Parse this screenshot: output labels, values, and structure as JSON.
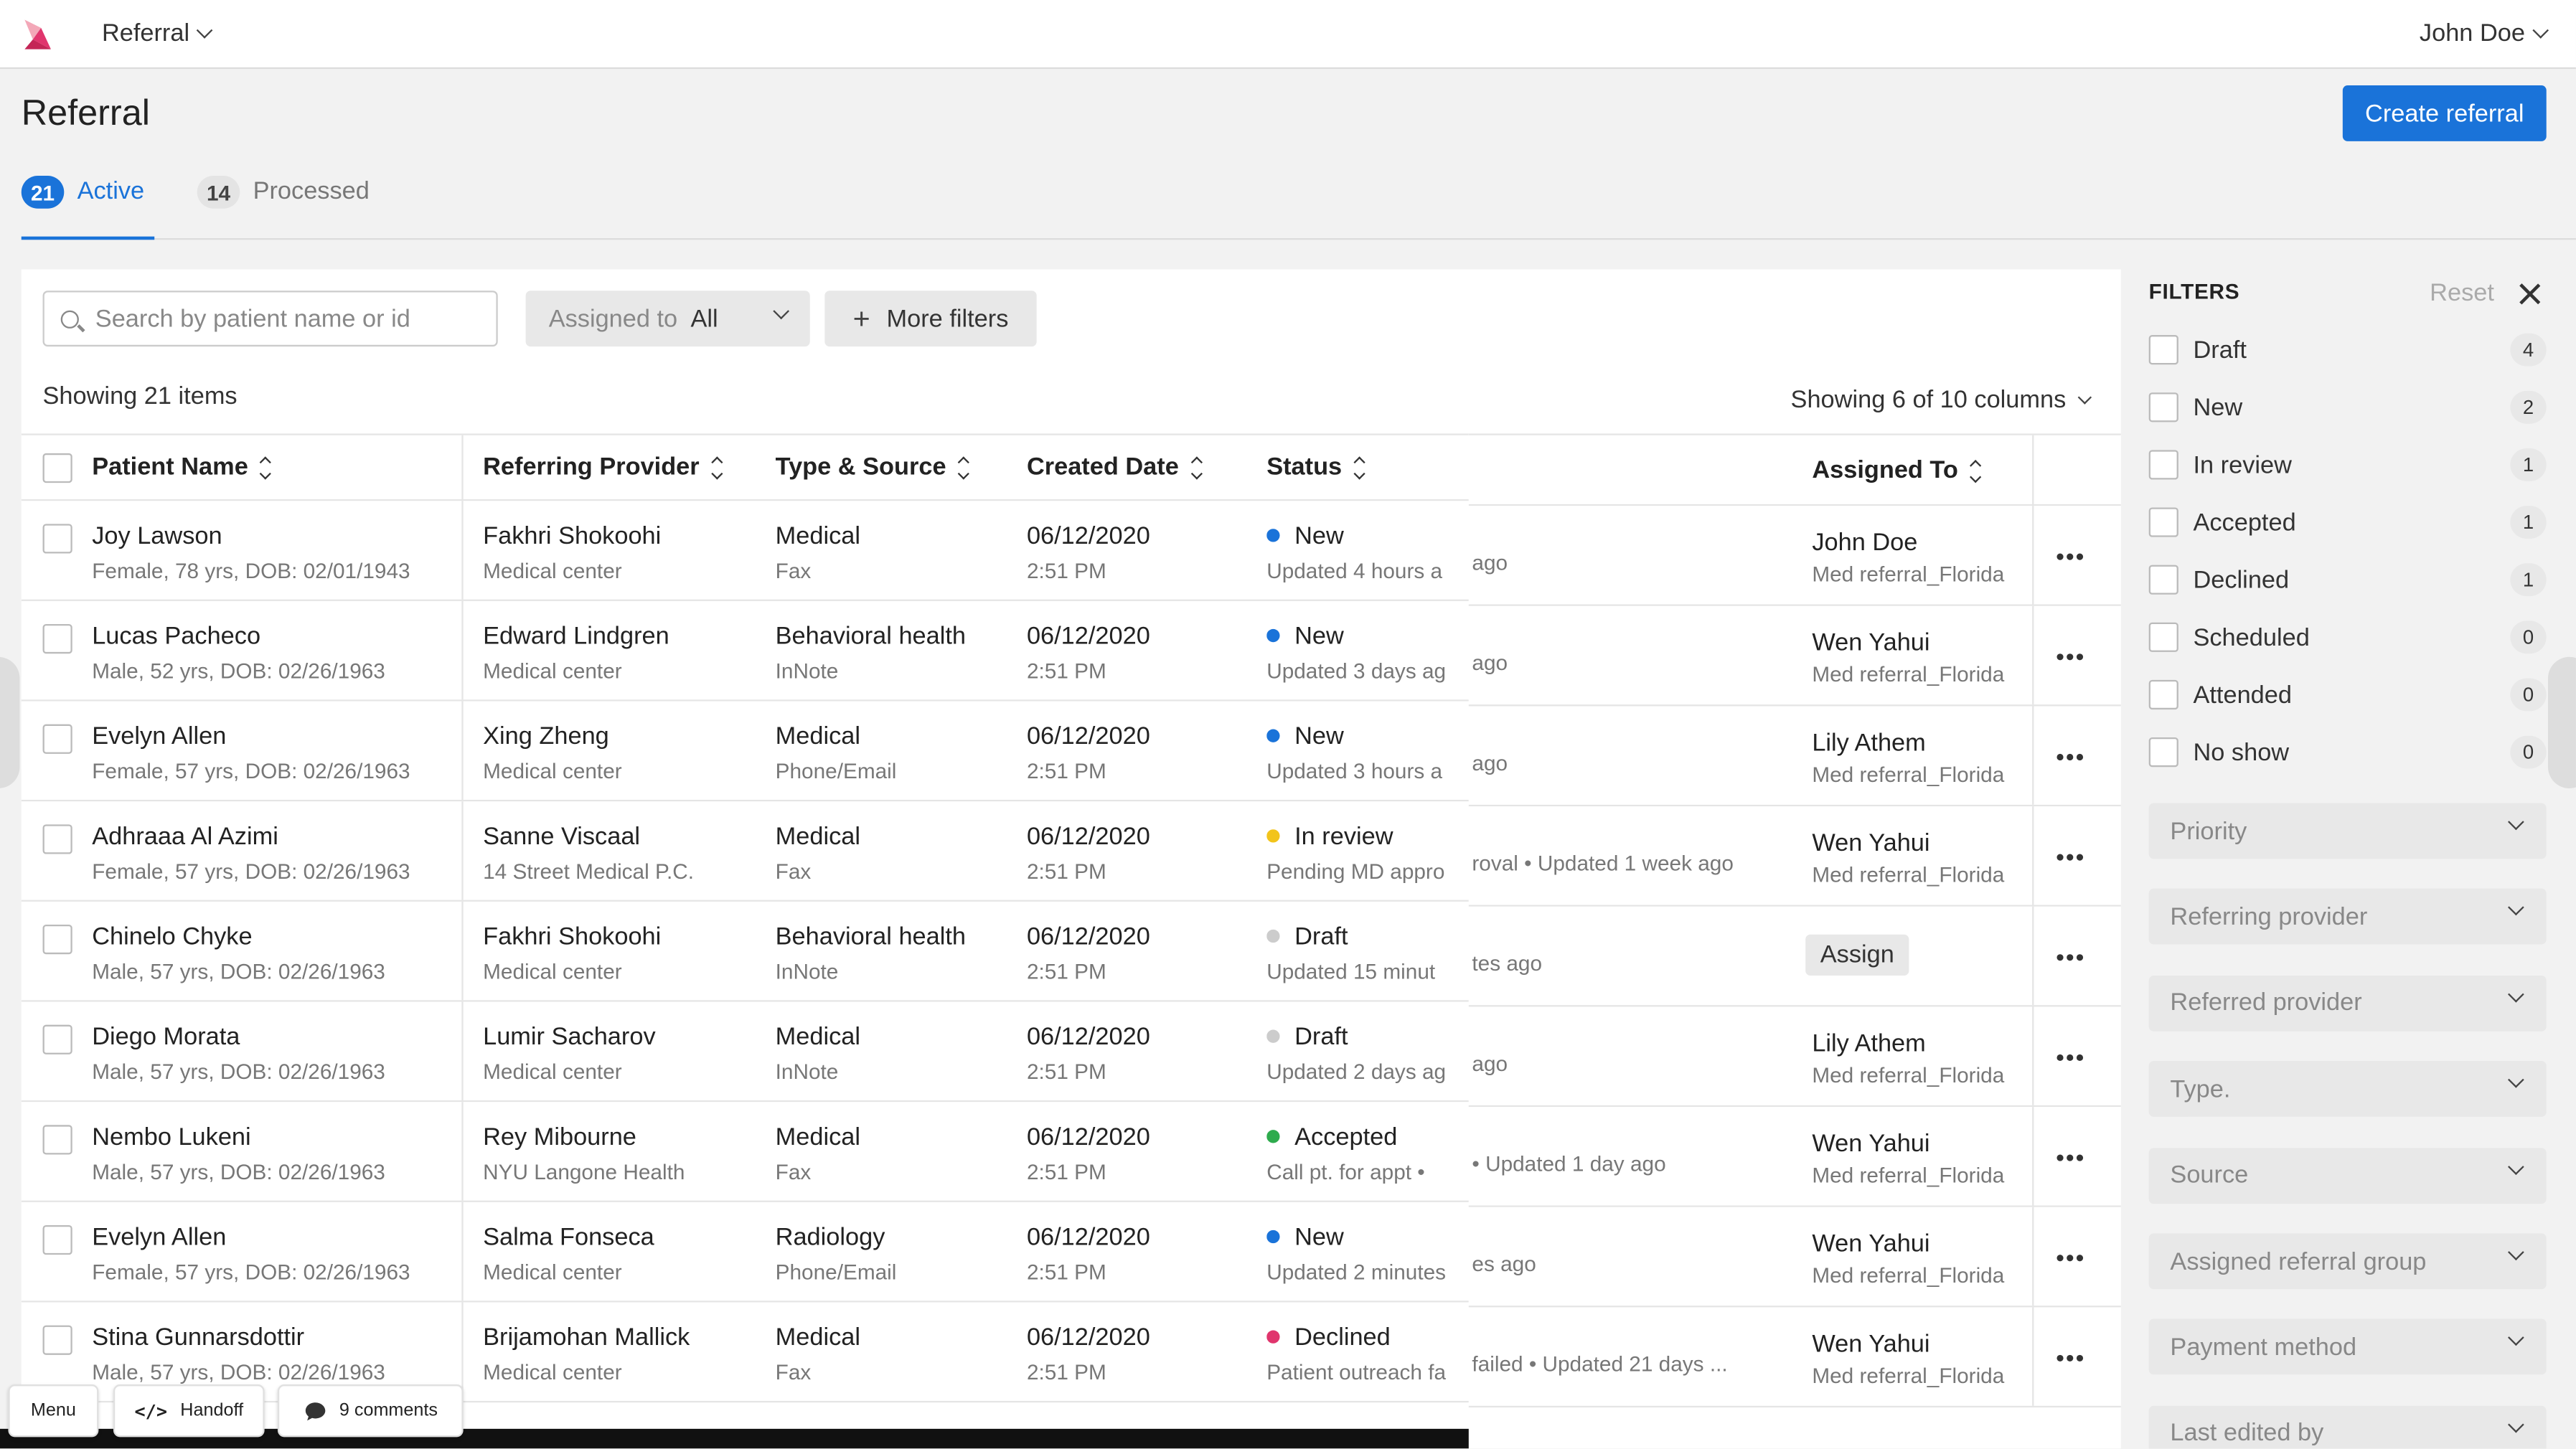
{
  "nav": {
    "app_name": "Referral",
    "user": "John Doe"
  },
  "page": {
    "title": "Referral",
    "create_button": "Create referral"
  },
  "tabs": [
    {
      "count": "21",
      "label": "Active",
      "active": true
    },
    {
      "count": "14",
      "label": "Processed",
      "active": false
    }
  ],
  "toolbar": {
    "search_placeholder": "Search by patient name or id",
    "assigned_label": "Assigned to",
    "assigned_value": "All",
    "more_filters": "More filters",
    "showing_items": "Showing 21 items",
    "showing_columns": "Showing 6 of 10 columns"
  },
  "table": {
    "headers": {
      "patient": "Patient Name",
      "provider": "Referring Provider",
      "type": "Type & Source",
      "created": "Created Date",
      "status": "Status",
      "assigned": "Assigned To"
    },
    "assign_label": "Assign",
    "rows": [
      {
        "name": "Joy Lawson",
        "info": "Female, 78 yrs, DOB: 02/01/1943",
        "provider": "Fakhri Shokoohi",
        "provider_sub": "Medical center",
        "type": "Medical",
        "source": "Fax",
        "date": "06/12/2020",
        "time": "2:51 PM",
        "status": "New",
        "status_color": "#1a73d9",
        "status_sub": "Updated 4 hours a",
        "status_overflow": "ago",
        "assignee": "John Doe",
        "group": "Med referral_Florida"
      },
      {
        "name": "Lucas Pacheco",
        "info": "Male, 52 yrs, DOB: 02/26/1963",
        "provider": "Edward Lindgren",
        "provider_sub": "Medical center",
        "type": "Behavioral health",
        "source": "InNote",
        "date": "06/12/2020",
        "time": "2:51 PM",
        "status": "New",
        "status_color": "#1a73d9",
        "status_sub": "Updated 3 days ag",
        "status_overflow": "ago",
        "assignee": "Wen Yahui",
        "group": "Med referral_Florida"
      },
      {
        "name": "Evelyn Allen",
        "info": "Female, 57 yrs, DOB: 02/26/1963",
        "provider": "Xing Zheng",
        "provider_sub": "Medical center",
        "type": "Medical",
        "source": "Phone/Email",
        "date": "06/12/2020",
        "time": "2:51 PM",
        "status": "New",
        "status_color": "#1a73d9",
        "status_sub": "Updated 3 hours a",
        "status_overflow": "ago",
        "assignee": "Lily Athem",
        "group": "Med referral_Florida"
      },
      {
        "name": "Adhraaa Al Azimi",
        "info": "Female, 57 yrs, DOB: 02/26/1963",
        "provider": "Sanne Viscaal",
        "provider_sub": "14 Street Medical P.C.",
        "type": "Medical",
        "source": "Fax",
        "date": "06/12/2020",
        "time": "2:51 PM",
        "status": "In review",
        "status_color": "#f2c41b",
        "status_sub": "Pending MD appro",
        "status_overflow": "roval  •  Updated 1 week ago",
        "assignee": "Wen Yahui",
        "group": "Med referral_Florida"
      },
      {
        "name": "Chinelo Chyke",
        "info": "Male, 57 yrs, DOB: 02/26/1963",
        "provider": "Fakhri Shokoohi",
        "provider_sub": "Medical center",
        "type": "Behavioral health",
        "source": "InNote",
        "date": "06/12/2020",
        "time": "2:51 PM",
        "status": "Draft",
        "status_color": "#cccccc",
        "status_sub": "Updated 15 minut",
        "status_overflow": "tes ago",
        "assignee": "",
        "group": ""
      },
      {
        "name": "Diego Morata",
        "info": "Male, 57 yrs, DOB: 02/26/1963",
        "provider": "Lumir Sacharov",
        "provider_sub": "Medical center",
        "type": "Medical",
        "source": "InNote",
        "date": "06/12/2020",
        "time": "2:51 PM",
        "status": "Draft",
        "status_color": "#cccccc",
        "status_sub": "Updated 2 days ag",
        "status_overflow": "ago",
        "assignee": "Lily Athem",
        "group": "Med referral_Florida"
      },
      {
        "name": "Nembo Lukeni",
        "info": "Male, 57 yrs, DOB: 02/26/1963",
        "provider": "Rey Mibourne",
        "provider_sub": "NYU Langone Health",
        "type": "Medical",
        "source": "Fax",
        "date": "06/12/2020",
        "time": "2:51 PM",
        "status": "Accepted",
        "status_color": "#2eab4d",
        "status_sub": "Call pt. for appt  •",
        "status_overflow": "•  Updated 1 day ago",
        "assignee": "Wen Yahui",
        "group": "Med referral_Florida"
      },
      {
        "name": "Evelyn Allen",
        "info": "Female, 57 yrs, DOB: 02/26/1963",
        "provider": "Salma Fonseca",
        "provider_sub": "Medical center",
        "type": "Radiology",
        "source": "Phone/Email",
        "date": "06/12/2020",
        "time": "2:51 PM",
        "status": "New",
        "status_color": "#1a73d9",
        "status_sub": "Updated 2 minutes",
        "status_overflow": "es ago",
        "assignee": "Wen Yahui",
        "group": "Med referral_Florida"
      },
      {
        "name": "Stina Gunnarsdottir",
        "info": "Male, 57 yrs, DOB: 02/26/1963",
        "provider": "Brijamohan Mallick",
        "provider_sub": "Medical center",
        "type": "Medical",
        "source": "Fax",
        "date": "06/12/2020",
        "time": "2:51 PM",
        "status": "Declined",
        "status_color": "#e0356d",
        "status_sub": "Patient outreach fa",
        "status_overflow": "failed  •  Updated 21 days ...",
        "assignee": "Wen Yahui",
        "group": "Med referral_Florida"
      }
    ]
  },
  "filters": {
    "title": "FILTERS",
    "reset": "Reset",
    "statuses": [
      {
        "label": "Draft",
        "count": "4"
      },
      {
        "label": "New",
        "count": "2"
      },
      {
        "label": "In review",
        "count": "1"
      },
      {
        "label": "Accepted",
        "count": "1"
      },
      {
        "label": "Declined",
        "count": "1"
      },
      {
        "label": "Scheduled",
        "count": "0"
      },
      {
        "label": "Attended",
        "count": "0"
      },
      {
        "label": "No show",
        "count": "0"
      }
    ],
    "dropdowns": [
      "Priority",
      "Referring provider",
      "Referred provider",
      "Type.",
      "Source",
      "Assigned referral group",
      "Payment method",
      "Last edited by"
    ]
  },
  "footer": {
    "menu": "Menu",
    "handoff": "Handoff",
    "comments": "9 comments"
  }
}
